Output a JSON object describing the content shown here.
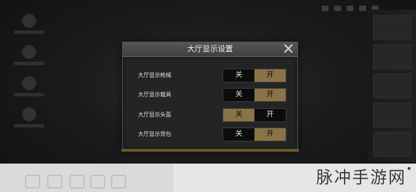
{
  "dialog": {
    "title": "大厅显示设置",
    "rows": [
      {
        "label": "大厅显示枪械",
        "off_label": "关",
        "on_label": "开",
        "selected": "on"
      },
      {
        "label": "大厅显示载具",
        "off_label": "关",
        "on_label": "开",
        "selected": "on"
      },
      {
        "label": "大厅显示头盔",
        "off_label": "关",
        "on_label": "开",
        "selected": "off"
      },
      {
        "label": "大厅显示背包",
        "off_label": "关",
        "on_label": "开",
        "selected": "on"
      }
    ]
  },
  "watermark": {
    "text": "脉冲手游网"
  },
  "colors": {
    "accent": "#8a7346",
    "dialog_bg": "#1e1f20",
    "header": "#4a4b4c",
    "off_bg": "#0c0c0c"
  },
  "icons": [
    "close-icon"
  ]
}
